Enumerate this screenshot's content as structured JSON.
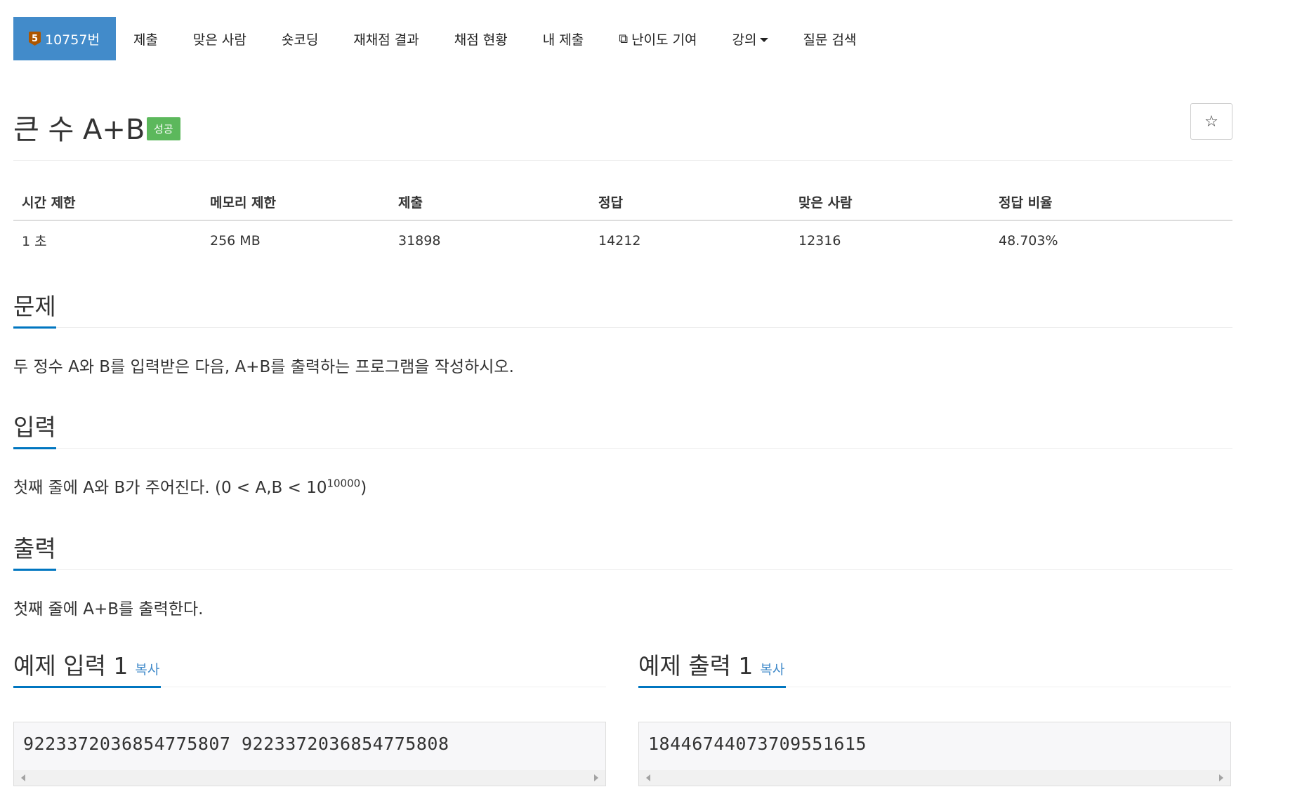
{
  "nav": {
    "problem_number": "10757번",
    "tier_badge": "5",
    "items": [
      "제출",
      "맞은 사람",
      "숏코딩",
      "재채점 결과",
      "채점 현황",
      "내 제출",
      "난이도 기여",
      "강의",
      "질문 검색"
    ]
  },
  "title": {
    "text": "큰 수 A+B",
    "status": "성공",
    "star_glyph": "☆"
  },
  "info": {
    "headers": [
      "시간 제한",
      "메모리 제한",
      "제출",
      "정답",
      "맞은 사람",
      "정답 비율"
    ],
    "values": [
      "1 초",
      "256 MB",
      "31898",
      "14212",
      "12316",
      "48.703%"
    ]
  },
  "problem": {
    "heading": "문제",
    "text": "두 정수 A와 B를 입력받은 다음, A+B를 출력하는 프로그램을 작성하시오."
  },
  "input": {
    "heading": "입력",
    "text": "첫째 줄에 A와 B가 주어진다. (0 < A,B < 10",
    "exponent": "10000",
    "suffix": ")"
  },
  "output": {
    "heading": "출력",
    "text": "첫째 줄에 A+B를 출력한다."
  },
  "samples": {
    "copy_label": "복사",
    "input_heading": "예제 입력 1",
    "input_value": "9223372036854775807 9223372036854775808",
    "output_heading": "예제 출력 1",
    "output_value": "18446744073709551615"
  },
  "colors": {
    "accent": "#428bca",
    "underline": "#0076c0",
    "success": "#5cb85c",
    "tier": "#ad5600"
  }
}
